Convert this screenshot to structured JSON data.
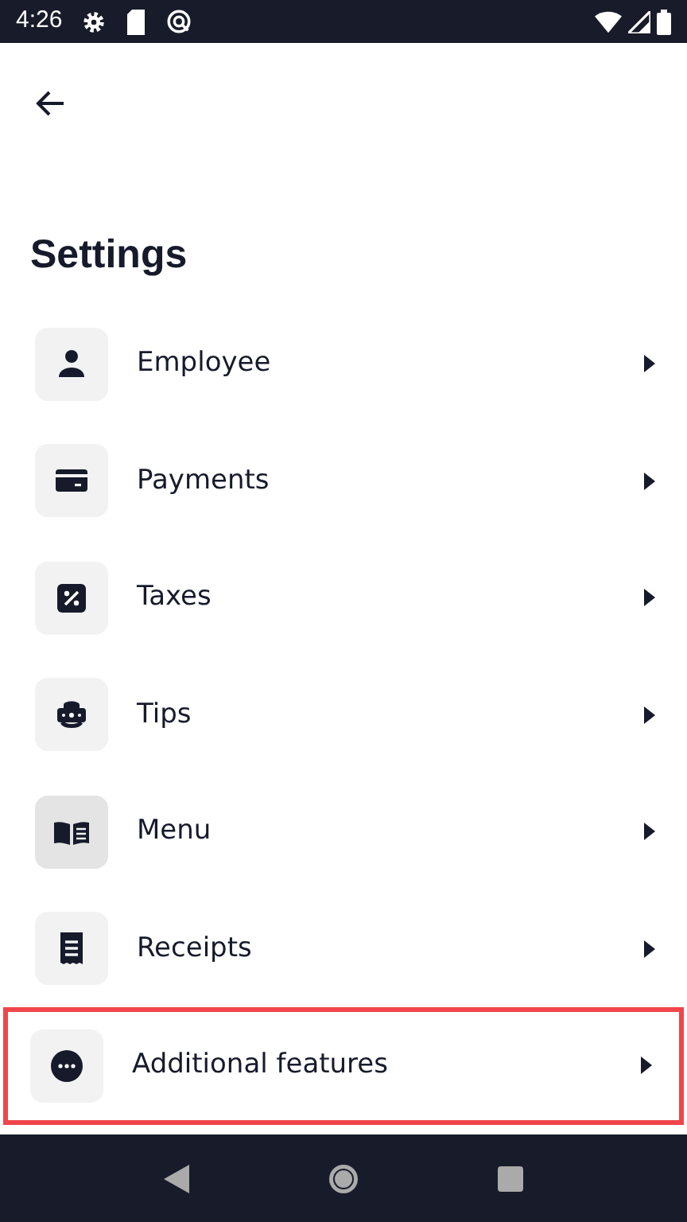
{
  "status_bar": {
    "time": "4:26"
  },
  "header": {
    "title": "Settings"
  },
  "items": [
    {
      "label": "Employee",
      "kind": "person",
      "selected": false,
      "highlighted": false
    },
    {
      "label": "Payments",
      "kind": "card",
      "selected": false,
      "highlighted": false
    },
    {
      "label": "Taxes",
      "kind": "percent",
      "selected": false,
      "highlighted": false
    },
    {
      "label": "Tips",
      "kind": "tips",
      "selected": false,
      "highlighted": false
    },
    {
      "label": "Menu",
      "kind": "book",
      "selected": true,
      "highlighted": false
    },
    {
      "label": "Receipts",
      "kind": "receipt",
      "selected": false,
      "highlighted": false
    },
    {
      "label": "Additional features",
      "kind": "more",
      "selected": false,
      "highlighted": true
    }
  ]
}
